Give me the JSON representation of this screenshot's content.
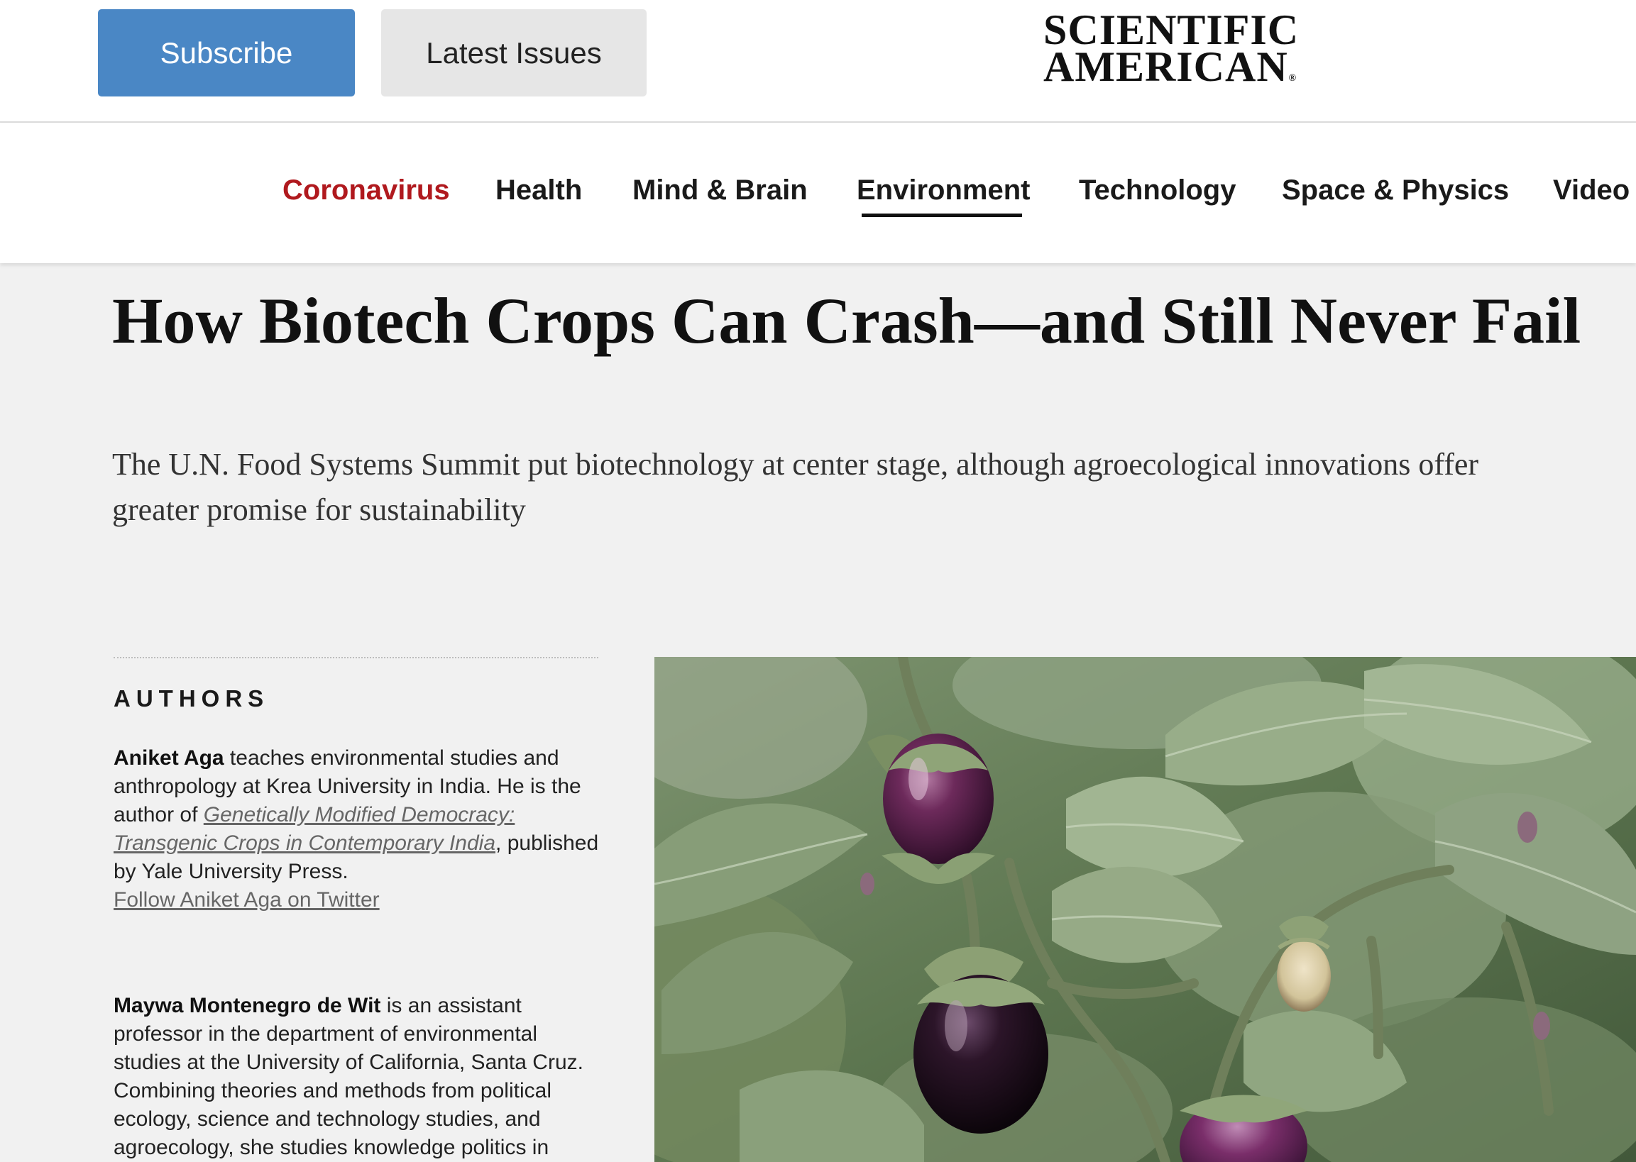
{
  "header": {
    "subscribe_label": "Subscribe",
    "latest_issues_label": "Latest Issues",
    "logo_line1": "SCIENTIFIC",
    "logo_line2": "AMERICAN",
    "logo_mark": "®"
  },
  "nav": {
    "items": [
      {
        "label": "Coronavirus"
      },
      {
        "label": "Health"
      },
      {
        "label": "Mind & Brain"
      },
      {
        "label": "Environment"
      },
      {
        "label": "Technology"
      },
      {
        "label": "Space & Physics"
      },
      {
        "label": "Video"
      }
    ],
    "active": "Environment",
    "highlight": "Coronavirus"
  },
  "article": {
    "title": "How Biotech Crops Can Crash—and Still Never Fail",
    "dek": "The U.N. Food Systems Summit put biotechnology at center stage, although agroecological innovations offer greater promise for sustainability",
    "authors_heading": "AUTHORS",
    "authors": [
      {
        "name": "Aniket Aga",
        "bio_before_link": " teaches environmental studies and anthropology at Krea University in India. He is the author of ",
        "book_title": "Genetically Modified Democracy: Transgenic Crops in Contemporary India",
        "bio_after_link": ", published by Yale University Press. ",
        "twitter": "Follow Aniket Aga on Twitter"
      },
      {
        "name": "Maywa Montenegro de Wit",
        "bio": " is an assistant professor in the department of environmental studies at the University of California, Santa Cruz. Combining theories and methods from political ecology, science and technology studies, and agroecology, she studies knowledge politics in"
      }
    ]
  },
  "hero_image": {
    "subject": "eggplant-plant-photo"
  },
  "colors": {
    "subscribe_bg": "#4a87c5",
    "latest_bg": "#e6e6e6",
    "highlight_red": "#b0191e",
    "page_bg": "#f1f1f1"
  }
}
